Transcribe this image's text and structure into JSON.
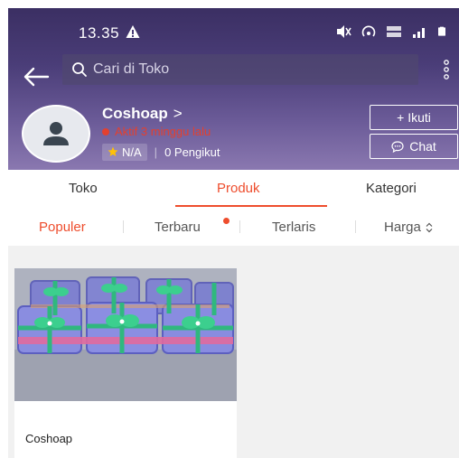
{
  "status_bar": {
    "time": "13.35"
  },
  "search": {
    "placeholder": "Cari di Toko"
  },
  "shop": {
    "name": "Coshoap",
    "name_chevron": ">",
    "active_status": "Aktif 3 minggu lalu",
    "rating": "N/A",
    "followers": "0 Pengikut"
  },
  "buttons": {
    "follow_label": "+ Ikuti",
    "chat_label": "Chat"
  },
  "tabs": [
    {
      "label": "Toko",
      "active": false
    },
    {
      "label": "Produk",
      "active": true
    },
    {
      "label": "Kategori",
      "active": false
    }
  ],
  "sort": [
    {
      "label": "Populer",
      "active": true
    },
    {
      "label": "Terbaru",
      "active": false,
      "has_new_dot": true
    },
    {
      "label": "Terlaris",
      "active": false
    },
    {
      "label": "Harga",
      "active": false,
      "icon": "sort-arrows-icon"
    }
  ],
  "products": [
    {
      "name": "Coshoap",
      "image": "gift-boxes-with-green-ribbons"
    }
  ],
  "colors": {
    "accent": "#ee4d2d",
    "header": "#4a3d78",
    "active_status": "#e3402f"
  }
}
